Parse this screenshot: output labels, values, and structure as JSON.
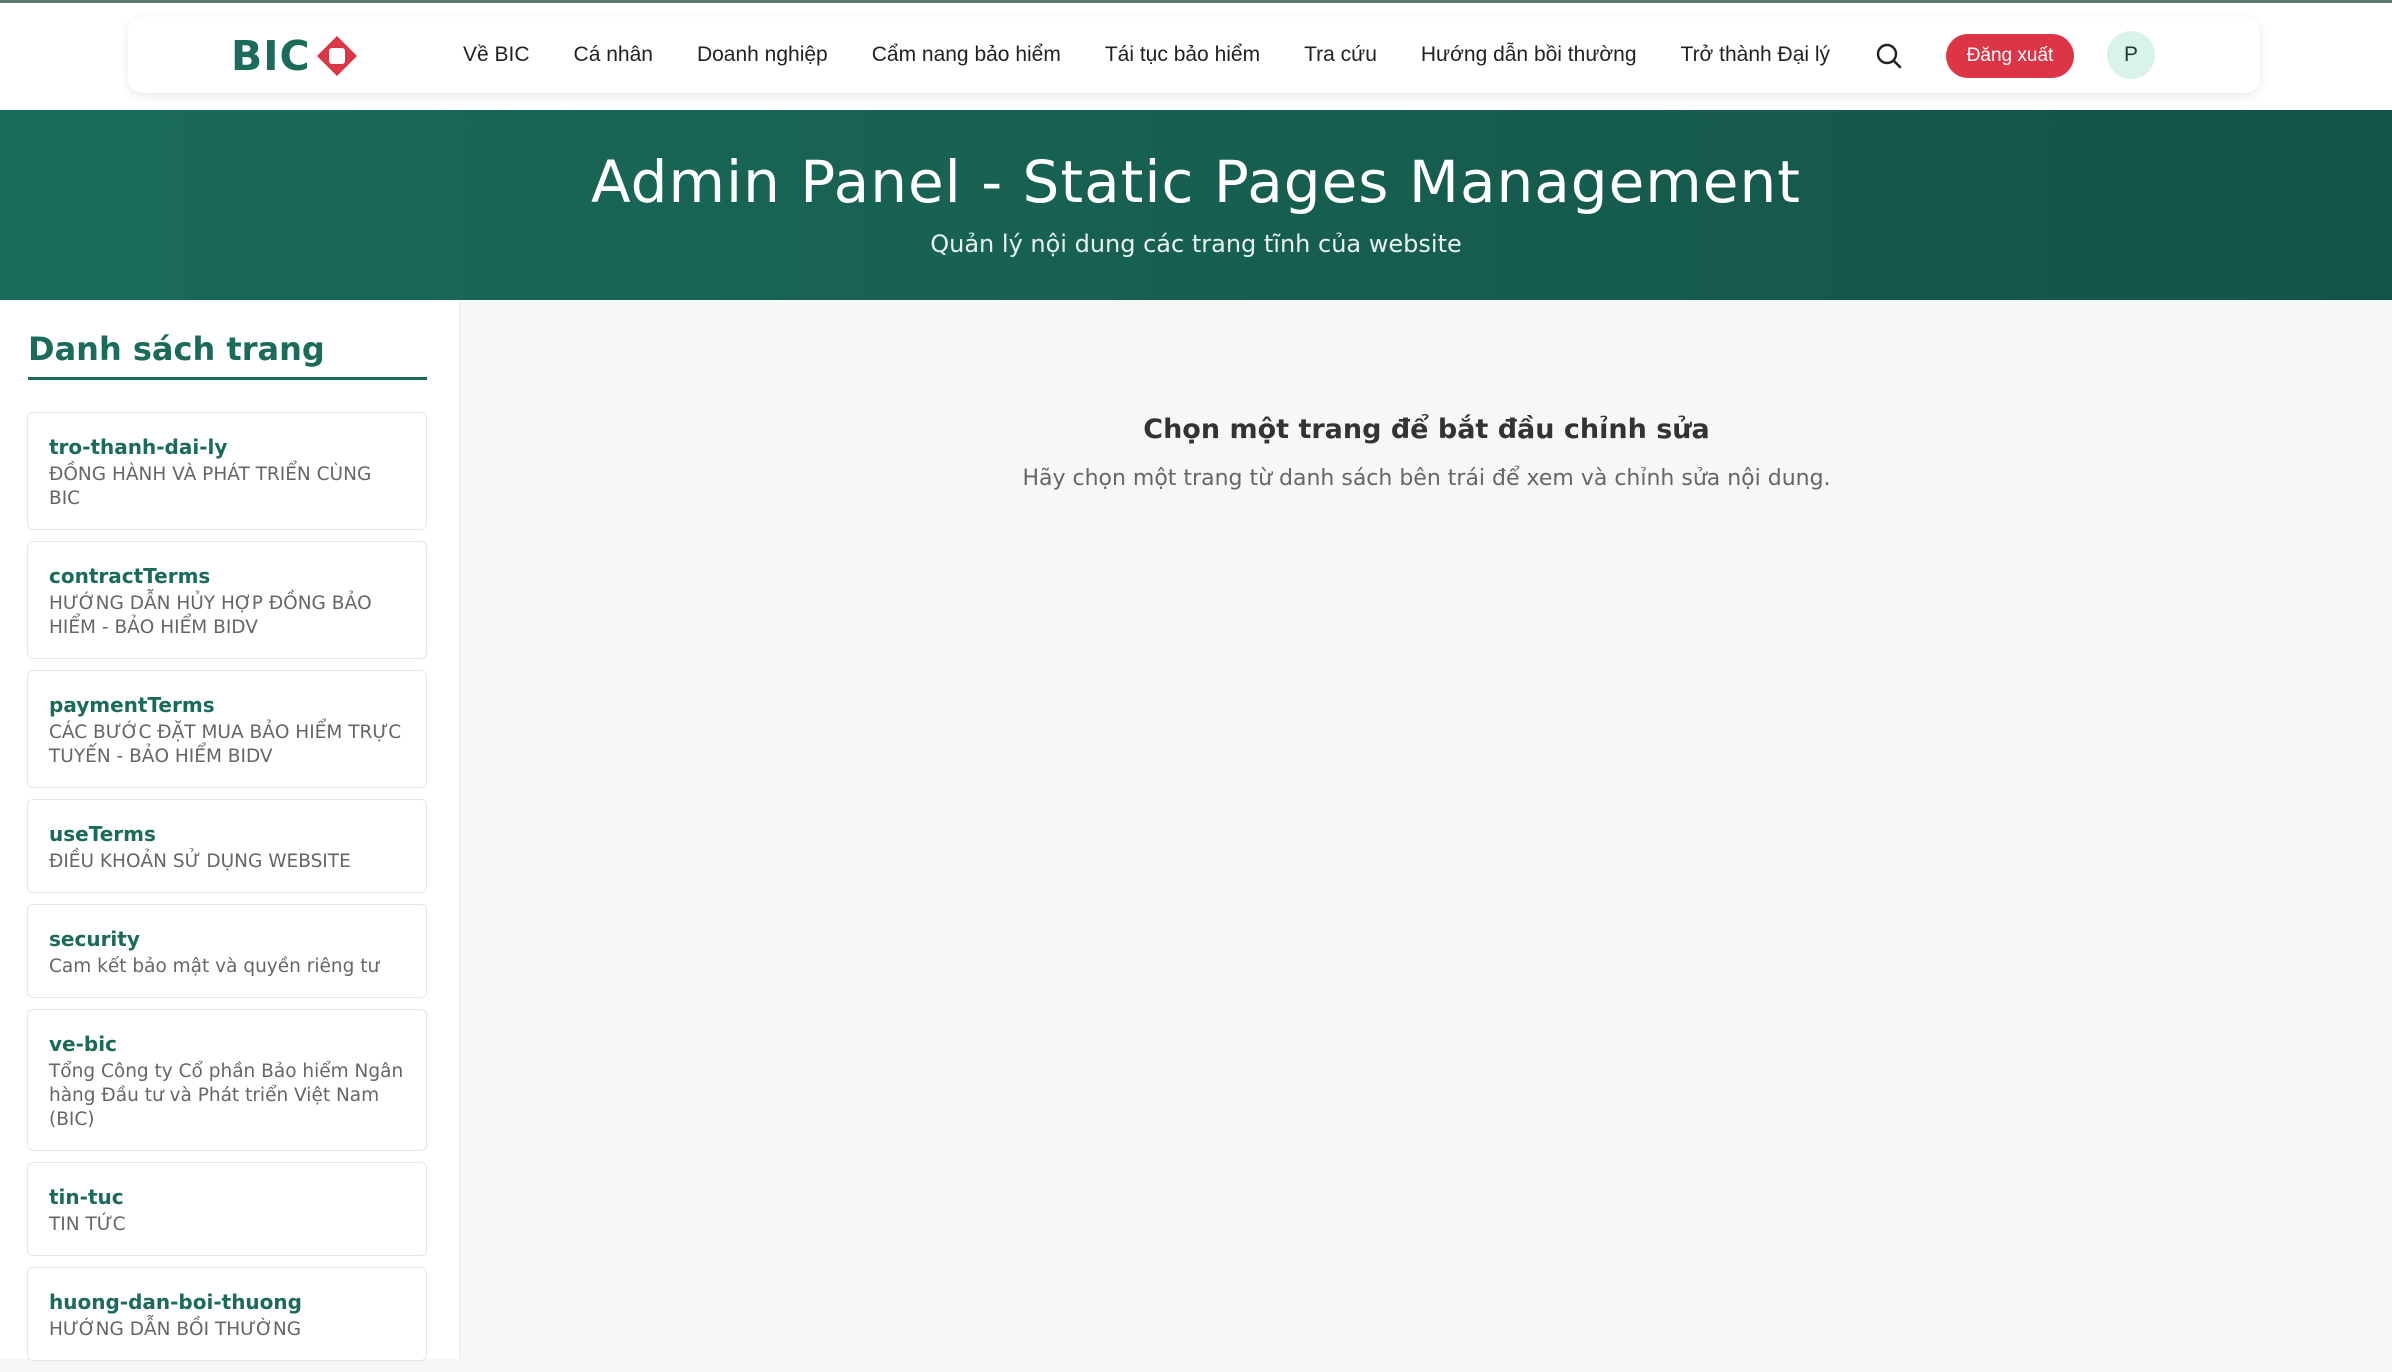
{
  "brand": {
    "logo_text": "BIC",
    "primary_color": "#1a6b5a",
    "accent_color": "#dc3545"
  },
  "nav": {
    "items": [
      {
        "label": "Về BIC"
      },
      {
        "label": "Cá nhân"
      },
      {
        "label": "Doanh nghiệp"
      },
      {
        "label": "Cẩm nang bảo hiểm"
      },
      {
        "label": "Tái tục bảo hiểm"
      },
      {
        "label": "Tra cứu"
      },
      {
        "label": "Hướng dẫn bồi thường"
      },
      {
        "label": "Trở thành Đại lý"
      }
    ],
    "search_icon": "search-icon",
    "logout_label": "Đăng xuất",
    "avatar_initial": "P"
  },
  "hero": {
    "title": "Admin Panel - Static Pages Management",
    "subtitle": "Quản lý nội dung các trang tĩnh của website"
  },
  "sidebar": {
    "title": "Danh sách trang",
    "pages": [
      {
        "slug": "tro-thanh-dai-ly",
        "description": "ĐỒNG HÀNH VÀ PHÁT TRIỂN CÙNG BIC"
      },
      {
        "slug": "contractTerms",
        "description": "HƯỚNG DẪN HỦY HỢP ĐỒNG BẢO HIỂM - BẢO HIỂM BIDV"
      },
      {
        "slug": "paymentTerms",
        "description": "CÁC BƯỚC ĐẶT MUA BẢO HIỂM TRỰC TUYẾN - BẢO HIỂM BIDV"
      },
      {
        "slug": "useTerms",
        "description": "ĐIỀU KHOẢN SỬ DỤNG WEBSITE"
      },
      {
        "slug": "security",
        "description": "Cam kết bảo mật và quyền riêng tư"
      },
      {
        "slug": "ve-bic",
        "description": "Tổng Công ty Cổ phần Bảo hiểm Ngân hàng Đầu tư và Phát triển Việt Nam (BIC)"
      },
      {
        "slug": "tin-tuc",
        "description": "TIN TỨC"
      },
      {
        "slug": "huong-dan-boi-thuong",
        "description": "HƯỚNG DẪN BỒI THƯỜNG"
      }
    ]
  },
  "main": {
    "empty_title": "Chọn một trang để bắt đầu chỉnh sửa",
    "empty_subtitle": "Hãy chọn một trang từ danh sách bên trái để xem và chỉnh sửa nội dung."
  }
}
